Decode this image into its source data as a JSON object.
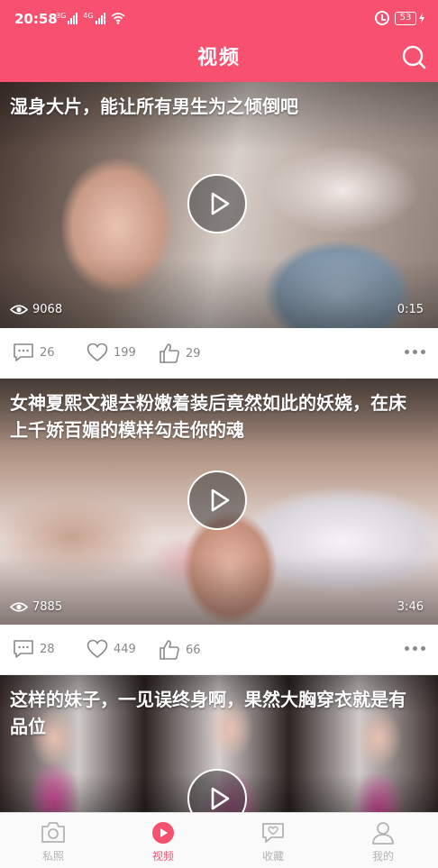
{
  "status_bar": {
    "time": "20:58",
    "network_1": "3G",
    "network_2": "4G",
    "battery": "53"
  },
  "header": {
    "title": "视频"
  },
  "feed": [
    {
      "title": "湿身大片，能让所有男生为之倾倒吧",
      "views": "9068",
      "duration": "0:15",
      "comments": "26",
      "likes": "199",
      "thumbs_up": "29"
    },
    {
      "title": "女神夏熙文褪去粉嫩着装后竟然如此的妖娆，在床上千娇百媚的模样勾走你的魂",
      "views": "7885",
      "duration": "3:46",
      "comments": "28",
      "likes": "449",
      "thumbs_up": "66"
    },
    {
      "title": "这样的妹子，一见误终身啊，果然大胸穿衣就是有品位"
    }
  ],
  "tabs": [
    {
      "label": "私照",
      "icon": "camera-icon"
    },
    {
      "label": "视频",
      "icon": "video-play-icon",
      "active": true
    },
    {
      "label": "收藏",
      "icon": "heart-chat-icon"
    },
    {
      "label": "我的",
      "icon": "person-icon"
    }
  ],
  "colors": {
    "brand": "#f8506f",
    "tab_inactive": "#b3b3b3",
    "action_gray": "#888888"
  }
}
